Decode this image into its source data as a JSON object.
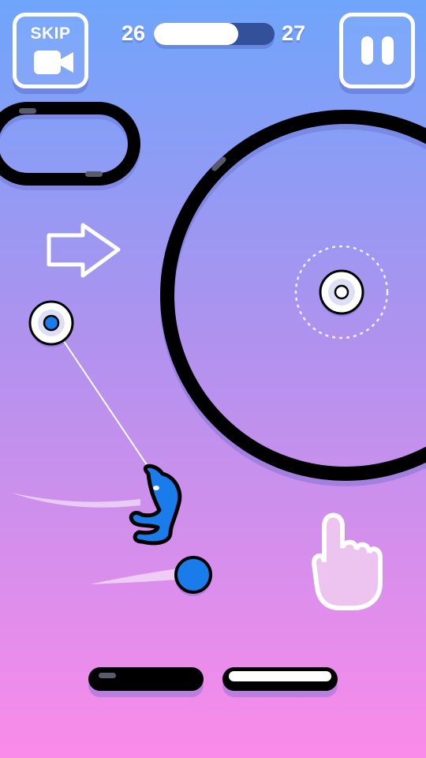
{
  "hud": {
    "skip_label": "SKIP",
    "skip_icon": "video-camera-icon",
    "pause_icon": "pause-icon",
    "level_current": "26",
    "level_next": "27",
    "level_progress": 0.7
  },
  "colors": {
    "bg_top": "#6fa5fb",
    "bg_mid": "#b092ee",
    "bg_bottom": "#fb8bea",
    "ring": "#000000",
    "ball": "#1a7bea",
    "character": "#1a7bea",
    "hud_white": "#ffffff"
  },
  "scene": {
    "hint_arrow_icon": "arrow-right-icon",
    "tap_hint_icon": "pointing-hand-icon"
  }
}
